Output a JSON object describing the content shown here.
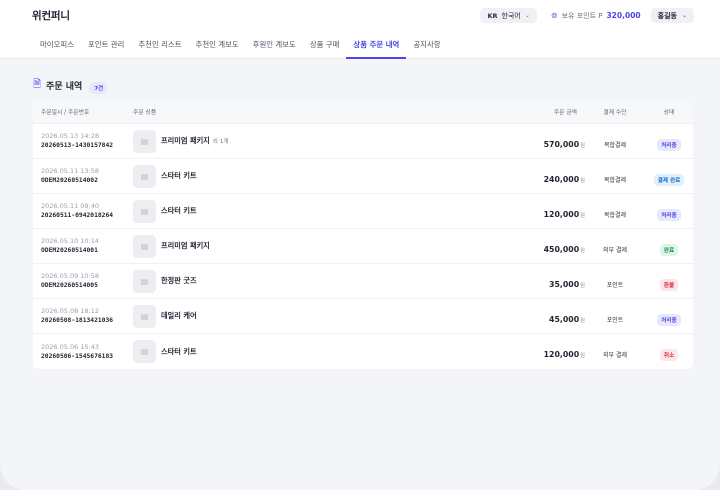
{
  "header": {
    "brand": "위컨퍼니",
    "lang_code": "KR",
    "lang_label": "한국어",
    "points_label": "보유 포인트 P",
    "points_value": "320,000",
    "user_name": "홍길동"
  },
  "nav": [
    {
      "label": "마이오피스",
      "active": false
    },
    {
      "label": "포인트 관리",
      "active": false
    },
    {
      "label": "추천인 리스트",
      "active": false
    },
    {
      "label": "추천인 계보도",
      "active": false
    },
    {
      "label": "후원인 계보도",
      "active": false
    },
    {
      "label": "상품 구매",
      "active": false
    },
    {
      "label": "상품 주문 내역",
      "active": true
    },
    {
      "label": "공지사항",
      "active": false
    }
  ],
  "section": {
    "title": "주문 내역",
    "count": "7건"
  },
  "table": {
    "columns": [
      "주문일시 / 주문번호",
      "주문 상품",
      "주문 금액",
      "결제 수단",
      "상태"
    ],
    "currency_unit": "원",
    "rows": [
      {
        "date": "2026.05.13 14:28",
        "order_id": "20260513-1430157842",
        "product": "프리미엄 패키지",
        "extra": "외 1개",
        "amount": "570,000",
        "payment": "복합결제",
        "status": "처리중",
        "status_type": "processing"
      },
      {
        "date": "2026.05.11 13:58",
        "order_id": "ODEM20260514002",
        "product": "스타터 키트",
        "extra": "",
        "amount": "240,000",
        "payment": "복합결제",
        "status": "결제 완료",
        "status_type": "paid"
      },
      {
        "date": "2026.05.11 09:40",
        "order_id": "20260511-0942018264",
        "product": "스타터 키트",
        "extra": "",
        "amount": "120,000",
        "payment": "복합결제",
        "status": "처리중",
        "status_type": "processing"
      },
      {
        "date": "2026.05.10 10:14",
        "order_id": "ODEM20260514001",
        "product": "프리미엄 패키지",
        "extra": "",
        "amount": "450,000",
        "payment": "외부 결제",
        "status": "완료",
        "status_type": "done"
      },
      {
        "date": "2026.05.09 10:58",
        "order_id": "ODEM20260514005",
        "product": "한정판 굿즈",
        "extra": "",
        "amount": "35,000",
        "payment": "포인트",
        "status": "환불",
        "status_type": "refund"
      },
      {
        "date": "2026.05.08 18:12",
        "order_id": "20260508-1813421036",
        "product": "데일리 케어",
        "extra": "",
        "amount": "45,000",
        "payment": "포인트",
        "status": "처리중",
        "status_type": "processing"
      },
      {
        "date": "2026.05.06 15:43",
        "order_id": "20260506-1545676183",
        "product": "스타터 키트",
        "extra": "",
        "amount": "120,000",
        "payment": "외부 결제",
        "status": "취소",
        "status_type": "cancel"
      }
    ]
  }
}
